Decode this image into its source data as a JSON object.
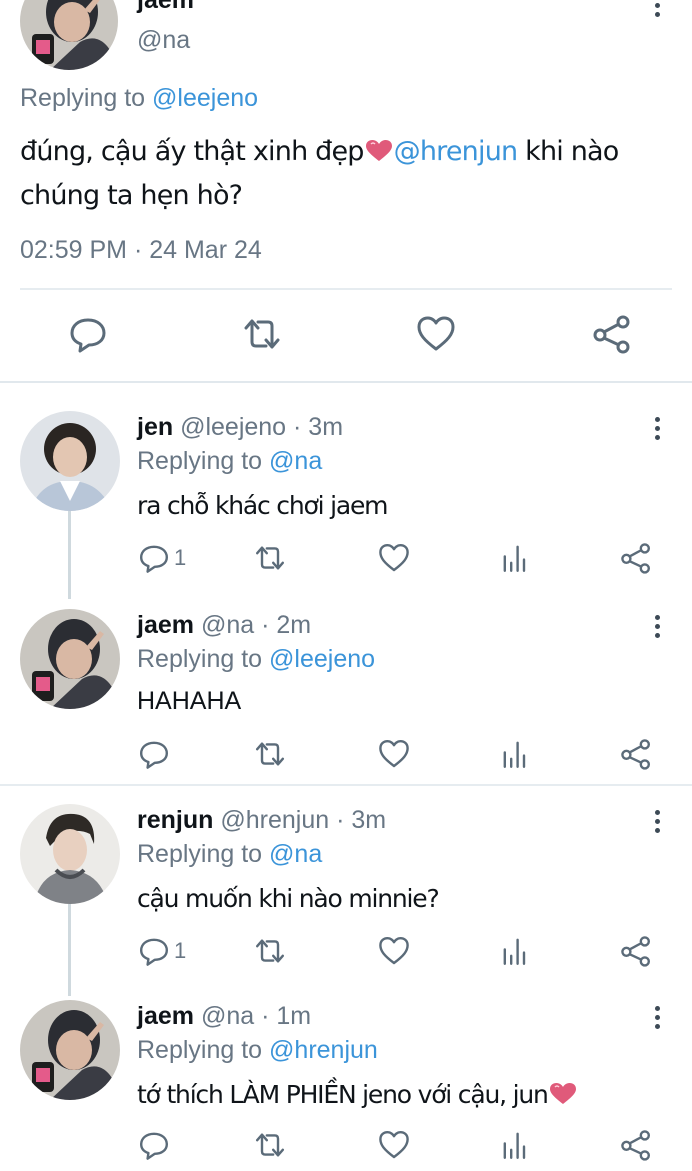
{
  "main_tweet": {
    "name": "jaem",
    "handle": "@na",
    "replying_prefix": "Replying to",
    "replying_to": "@leejeno",
    "text_before": "đúng, cậu ấy thật xinh đẹp",
    "mention": "@hrenjun",
    "text_after": " khi nào chúng ta hẹn hò?",
    "timestamp": "02:59 PM · 24 Mar 24",
    "icons": [
      "reply-icon",
      "retweet-icon",
      "like-icon",
      "share-icon"
    ]
  },
  "replies": [
    {
      "name": "jen",
      "meta": "@leejeno · 3m",
      "replying_prefix": "Replying to",
      "replying_to": "@na",
      "text": "ra chỗ khác chơi jaem",
      "reply_count": "1",
      "avatar": "jen-avatar"
    },
    {
      "name": "jaem",
      "meta": "@na · 2m",
      "replying_prefix": "Replying to",
      "replying_to": "@leejeno",
      "text": "HAHAHA",
      "reply_count": "",
      "avatar": "jaem-avatar"
    },
    {
      "name": "renjun",
      "meta": "@hrenjun · 3m",
      "replying_prefix": "Replying to",
      "replying_to": "@na",
      "text": "cậu muốn khi nào minnie?",
      "reply_count": "1",
      "avatar": "renjun-avatar"
    },
    {
      "name": "jaem",
      "meta": "@na · 1m",
      "replying_prefix": "Replying to",
      "replying_to": "@hrenjun",
      "text": "tớ thích LÀM PHIỀN jeno với cậu, jun",
      "reply_count": "",
      "avatar": "jaem-avatar"
    }
  ],
  "colors": {
    "link": "#3b94d9",
    "secondary_text": "#687684",
    "icon": "#5b6b79",
    "heart_emoji": "#e05a7a"
  }
}
